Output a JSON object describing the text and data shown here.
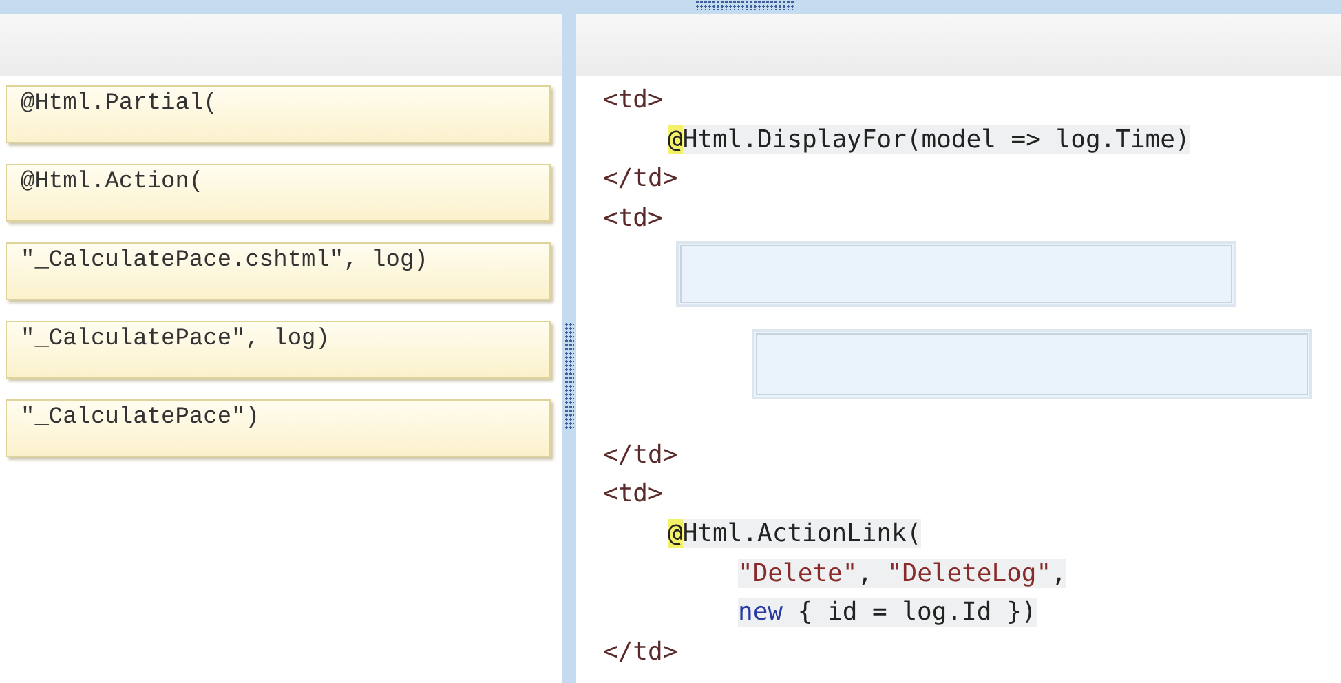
{
  "choices": [
    {
      "text": "@Html.Partial("
    },
    {
      "text": "@Html.Action("
    },
    {
      "text": "\"_CalculatePace.cshtml\", log)"
    },
    {
      "text": "\"_CalculatePace\", log)"
    },
    {
      "text": "\"_CalculatePace\")"
    }
  ],
  "code_lines": [
    {
      "kind": "tag",
      "segments": [
        {
          "kind": "tag",
          "text": "<td>"
        }
      ]
    },
    {
      "kind": "expr",
      "segments": [
        {
          "kind": "razor",
          "text": "@"
        },
        {
          "kind": "code",
          "text": "Html.DisplayFor(model => log.Time)"
        }
      ]
    },
    {
      "kind": "tag",
      "segments": [
        {
          "kind": "tag",
          "text": "</td>"
        }
      ]
    },
    {
      "kind": "tag",
      "segments": [
        {
          "kind": "tag",
          "text": "<td>"
        }
      ]
    },
    {
      "kind": "slot"
    },
    {
      "kind": "slot-nested"
    },
    {
      "kind": "tag",
      "segments": [
        {
          "kind": "tag",
          "text": "</td>"
        }
      ]
    },
    {
      "kind": "tag",
      "segments": [
        {
          "kind": "tag",
          "text": "<td>"
        }
      ]
    },
    {
      "kind": "expr",
      "segments": [
        {
          "kind": "razor",
          "text": "@"
        },
        {
          "kind": "code",
          "text": "Html.ActionLink("
        }
      ]
    },
    {
      "kind": "arg",
      "segments": [
        {
          "kind": "string",
          "text": "\"Delete\""
        },
        {
          "kind": "code",
          "text": ", "
        },
        {
          "kind": "string",
          "text": "\"DeleteLog\""
        },
        {
          "kind": "code",
          "text": ","
        }
      ]
    },
    {
      "kind": "arg",
      "segments": [
        {
          "kind": "keyword",
          "text": "new"
        },
        {
          "kind": "code",
          "text": " { id = log.Id })"
        }
      ]
    },
    {
      "kind": "tag",
      "segments": [
        {
          "kind": "tag",
          "text": "</td>"
        }
      ]
    }
  ]
}
